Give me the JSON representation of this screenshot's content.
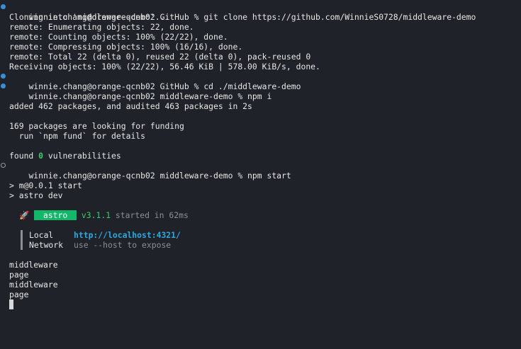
{
  "terminal": {
    "lines": {
      "l1": "winnie.chang@orange-qcnb02 GitHub % git clone https://github.com/WinnieS0728/middleware-demo",
      "l2": "Cloning into 'middleware-demo'...",
      "l3": "remote: Enumerating objects: 22, done.",
      "l4": "remote: Counting objects: 100% (22/22), done.",
      "l5": "remote: Compressing objects: 100% (16/16), done.",
      "l6": "remote: Total 22 (delta 0), reused 22 (delta 0), pack-reused 0",
      "l7": "Receiving objects: 100% (22/22), 56.46 KiB | 578.00 KiB/s, done.",
      "l8": "winnie.chang@orange-qcnb02 GitHub % cd ./middleware-demo",
      "l9": "winnie.chang@orange-qcnb02 middleware-demo % npm i",
      "l10": "added 462 packages, and audited 463 packages in 2s",
      "l11": "169 packages are looking for funding",
      "l12": "  run `npm fund` for details",
      "l13_pre": "found ",
      "l13_count": "0",
      "l13_post": " vulnerabilities",
      "l14": "winnie.chang@orange-qcnb02 middleware-demo % npm start",
      "l15": "> m@0.0.1 start",
      "l16": "> astro dev",
      "astro_badge": " astro ",
      "astro_version": "v3.1.1",
      "astro_started": " started in 62ms",
      "local_label": "Local",
      "local_url": "http://localhost:4321/",
      "network_label": "Network",
      "network_value": "use --host to expose",
      "out1": "middleware",
      "out2": "page",
      "out3": "middleware",
      "out4": "page"
    },
    "colors": {
      "background": "#1f2329",
      "badge": "#12b76a",
      "link": "#2fa7e0",
      "marker": "#3b8fd6"
    }
  }
}
